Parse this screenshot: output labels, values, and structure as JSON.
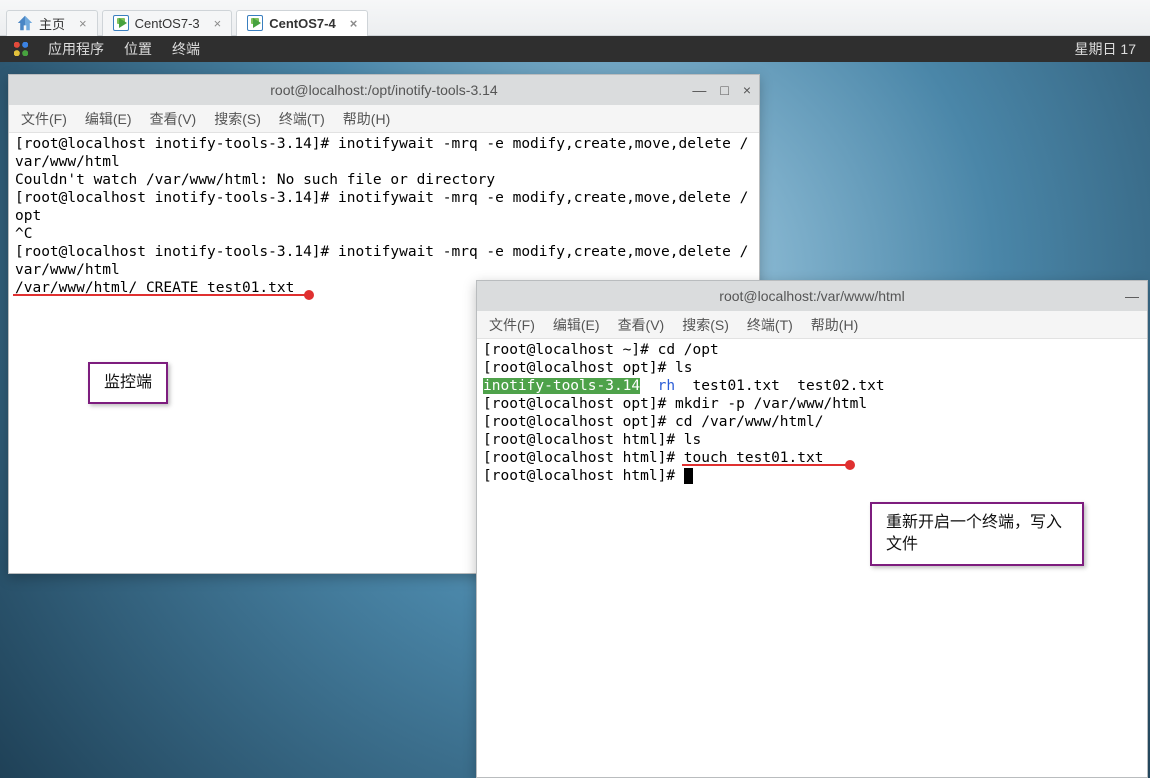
{
  "vmtabs": {
    "home": "主页",
    "tab1": "CentOS7-3",
    "tab2": "CentOS7-4"
  },
  "desktopbar": {
    "apps": "应用程序",
    "places": "位置",
    "terminal": "终端",
    "clock": "星期日 17"
  },
  "term1": {
    "title": "root@localhost:/opt/inotify-tools-3.14",
    "menu": {
      "file": "文件(F)",
      "edit": "编辑(E)",
      "view": "查看(V)",
      "search": "搜索(S)",
      "term": "终端(T)",
      "help": "帮助(H)"
    },
    "lines": [
      "[root@localhost inotify-tools-3.14]# inotifywait -mrq -e modify,create,move,delete /var/www/html",
      "Couldn't watch /var/www/html: No such file or directory",
      "[root@localhost inotify-tools-3.14]# inotifywait -mrq -e modify,create,move,delete /opt",
      "^C",
      "[root@localhost inotify-tools-3.14]# inotifywait -mrq -e modify,create,move,delete /var/www/html",
      "/var/www/html/ CREATE test01.txt"
    ]
  },
  "term2": {
    "title": "root@localhost:/var/www/html",
    "menu": {
      "file": "文件(F)",
      "edit": "编辑(E)",
      "view": "查看(V)",
      "search": "搜索(S)",
      "term": "终端(T)",
      "help": "帮助(H)"
    },
    "l1": "[root@localhost ~]# cd /opt",
    "l2": "[root@localhost opt]# ls",
    "l3a": "inotify-tools-3.14",
    "l3b": "rh",
    "l3c": "  test01.txt  test02.txt",
    "l4": "[root@localhost opt]# mkdir -p /var/www/html",
    "l5": "[root@localhost opt]# cd /var/www/html/",
    "l6": "[root@localhost html]# ls",
    "l7": "[root@localhost html]# touch test01.txt",
    "l8": "[root@localhost html]# "
  },
  "annot1": "监控端",
  "annot2": "重新开启一个终端，写入文件"
}
